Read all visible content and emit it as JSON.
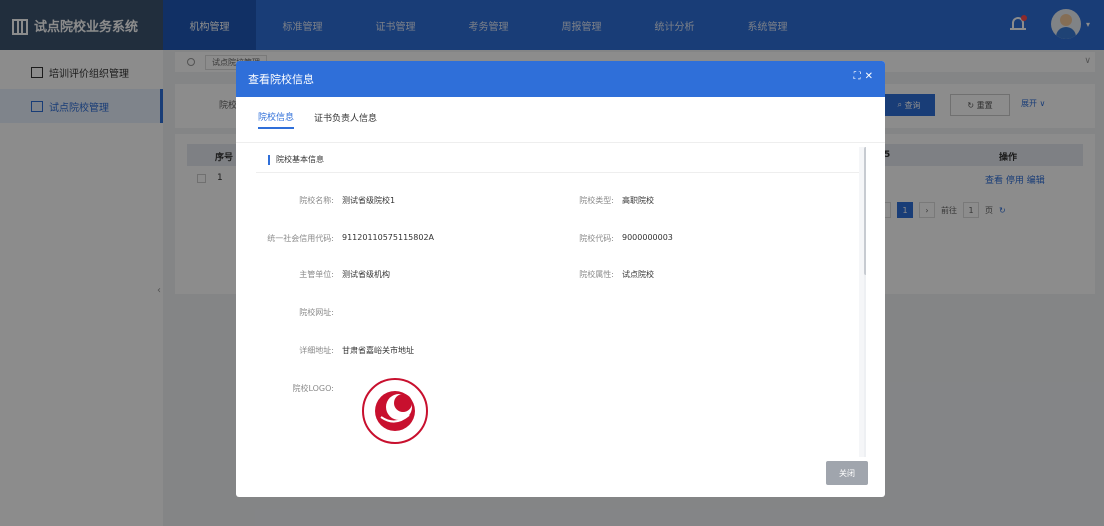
{
  "app": {
    "title": "试点院校业务系统"
  },
  "nav": {
    "items": [
      "机构管理",
      "标准管理",
      "证书管理",
      "考务管理",
      "周报管理",
      "统计分析",
      "系统管理"
    ]
  },
  "sidebar": {
    "items": [
      {
        "label": "培训评价组织管理"
      },
      {
        "label": "试点院校管理"
      }
    ]
  },
  "main": {
    "tab_label": "试点院校管理",
    "search": {
      "label": "院校",
      "query_label": "查询",
      "reset_label": "重置",
      "expand_label": "展开"
    },
    "table": {
      "seq_header": "序号",
      "col5_header": "5",
      "ops_header": "操作",
      "row_seq": "1",
      "ops": "查看 停用 编辑"
    },
    "pager": {
      "page": "1",
      "goto_label": "前往",
      "page_unit": "页"
    }
  },
  "modal": {
    "title": "查看院校信息",
    "tabs": [
      "院校信息",
      "证书负责人信息"
    ],
    "section_title": "院校基本信息",
    "fields": {
      "name_label": "院校名称:",
      "name_value": "测试省级院校1",
      "type_label": "院校类型:",
      "type_value": "高职院校",
      "credit_label": "统一社会信用代码:",
      "credit_value": "91120110575115802A",
      "code_label": "院校代码:",
      "code_value": "9000000003",
      "dept_label": "主管单位:",
      "dept_value": "测试省级机构",
      "attr_label": "院校属性:",
      "attr_value": "试点院校",
      "web_label": "院校网址:",
      "web_value": "",
      "addr_label": "详细地址:",
      "addr_value": "甘肃省嘉峪关市地址",
      "logo_label": "院校LOGO:"
    },
    "close_label": "关闭"
  },
  "colors": {
    "primary": "#2f6fd9",
    "brand_bg": "#3d5470"
  },
  "icons": [
    "book-icon",
    "bell-icon",
    "avatar",
    "org-icon",
    "school-icon",
    "fullscreen-icon",
    "close-icon"
  ]
}
